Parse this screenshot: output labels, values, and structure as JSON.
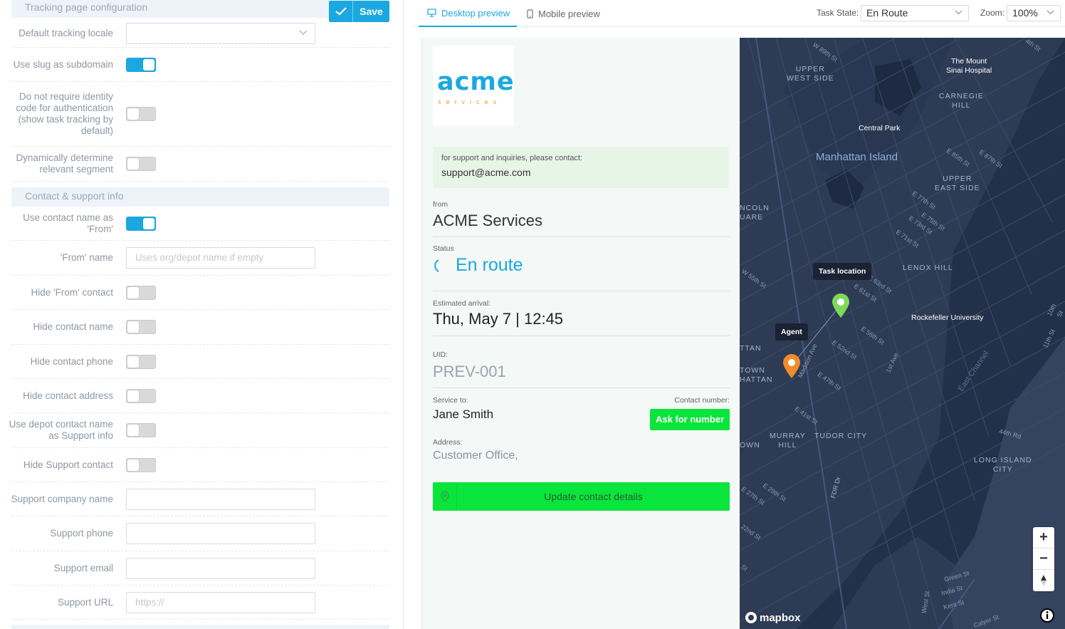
{
  "left": {
    "tracking_section_title": "Tracking page configuration",
    "save_label": "Save",
    "contact_section_title": "Contact & support info",
    "rows": [
      {
        "label": "Default tracking locale",
        "value": ""
      },
      {
        "label": "Use slug as subdomain",
        "state": "on"
      },
      {
        "label": "Do not require identity code for authentication (show task tracking by default)",
        "state": "off"
      },
      {
        "label": "Dynamically determine relevant segment",
        "state": "off"
      },
      {
        "label": "Use contact name as 'From'",
        "state": "on"
      },
      {
        "label": "'From' name",
        "placeholder": "Uses org/depot name if empty"
      },
      {
        "label": "Hide 'From' contact",
        "state": "off"
      },
      {
        "label": "Hide contact name",
        "state": "off"
      },
      {
        "label": "Hide contact phone",
        "state": "off"
      },
      {
        "label": "Hide contact address",
        "state": "off"
      },
      {
        "label": "Use depot contact name as Support info",
        "state": "off"
      },
      {
        "label": "Hide Support contact",
        "state": "off"
      },
      {
        "label": "Support company name",
        "value": ""
      },
      {
        "label": "Support phone",
        "value": ""
      },
      {
        "label": "Support email",
        "value": ""
      },
      {
        "label": "Support URL",
        "placeholder": "https://"
      }
    ]
  },
  "header": {
    "tab_desktop": "Desktop preview",
    "tab_mobile": "Mobile preview",
    "task_state_label": "Task State:",
    "task_state_value": "En Route",
    "zoom_label": "Zoom:",
    "zoom_value": "100%"
  },
  "preview": {
    "logo_main": "acme",
    "logo_sub": "services",
    "support_text": "for support and inquiries, please contact:",
    "support_email": "support@acme.com",
    "from_caption": "from",
    "from_value": "ACME Services",
    "status_caption": "Status",
    "status_value": "En route",
    "eta_caption": "Estimated arrival:",
    "eta_value": "Thu, May 7 | 12:45",
    "uid_caption": "UID:",
    "uid_value": "PREV-001",
    "service_caption": "Service to:",
    "service_value": "Jane Smith",
    "contact_caption": "Contact number:",
    "ask_button": "Ask for number",
    "address_caption": "Address:",
    "address_value": "Customer Office,",
    "update_button": "Update contact details",
    "accent_color": "#1ba8e0",
    "button_color": "#0ae53b"
  },
  "map": {
    "labels": {
      "upper_west_side": "UPPER\nWEST SIDE",
      "mount_sinai": "The Mount\nSinai Hospital",
      "carnegie_hill": "CARNEGIE\nHILL",
      "central_park": "Central Park",
      "manhattan_island": "Manhattan Island",
      "upper_east_side": "UPPER\nEAST SIDE",
      "lincoln_square": "NCOLN\nUARE",
      "lenox_hill": "LENOX HILL",
      "rockefeller": "Rockefeller University",
      "midtown": "TTAN",
      "midtown2": "TOWN\nHATTAN",
      "murray_hill": "MURRAY\nHILL",
      "tudor_city": "TUDOR CITY",
      "own": "OWN",
      "long_island_city": "LONG ISLAND\nCITY",
      "east_channel": "East Channel",
      "fdr": "FDR Dr",
      "w89": "W 89th St",
      "e85": "E 85th St",
      "e87": "E 87th St",
      "e77": "E 77th St",
      "e75": "E 75th St",
      "e73": "E 73rd St",
      "e71": "E 71st St",
      "w55": "W 55th St",
      "e63": "E 63rd St",
      "e61": "E 61st St",
      "e56": "E 56th St",
      "e52": "E 52nd St",
      "e47": "E 47th St",
      "e41": "E 41st St",
      "e29": "E 29th St",
      "e27": "E 27th St",
      "madison": "Madison Ave",
      "first_ave": "1st Ave",
      "st44": "44th Rd",
      "green": "Green St",
      "india": "India St",
      "kent": "Kent St",
      "calyer": "Calyer St",
      "west_st": "West St",
      "s22": "22nd St",
      "s10": "10th St",
      "s11": "11th St",
      "s4": "4th St",
      "st_left": "St"
    },
    "task_bubble": "Task location",
    "agent_bubble": "Agent",
    "attribution": "mapbox",
    "zoom_in": "+",
    "zoom_out": "−",
    "task_pin_color": "#7ed957",
    "agent_pin_color": "#f28c28"
  }
}
